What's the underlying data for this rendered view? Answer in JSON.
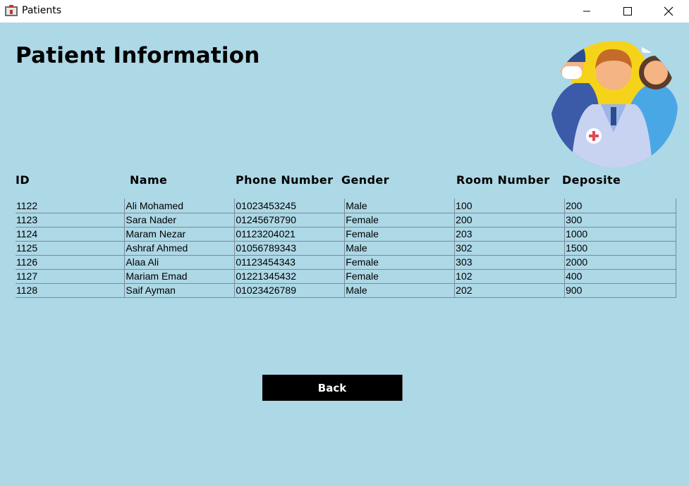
{
  "window": {
    "title": "Patients"
  },
  "page": {
    "title": "Patient Information"
  },
  "table": {
    "headers": [
      "ID",
      "Name",
      "Phone Number",
      "Gender",
      "Room Number",
      "Deposite"
    ],
    "rows": [
      [
        "1122",
        "Ali Mohamed",
        "01023453245",
        "Male",
        "100",
        "200"
      ],
      [
        "1123",
        "Sara Nader",
        "01245678790",
        "Female",
        "200",
        "300"
      ],
      [
        "1124",
        "Maram Nezar",
        "01123204021",
        "Female",
        "203",
        "1000"
      ],
      [
        "1125",
        "Ashraf Ahmed",
        "01056789343",
        "Male",
        "302",
        "1500"
      ],
      [
        "1126",
        "Alaa Ali",
        "01123454343",
        "Female",
        "303",
        "2000"
      ],
      [
        "1127",
        "Mariam Emad",
        "01221345432",
        "Female",
        "102",
        "400"
      ],
      [
        "1128",
        "Saif Ayman",
        "01023426789",
        "Male",
        "202",
        "900"
      ]
    ]
  },
  "buttons": {
    "back": "Back"
  },
  "icons": {
    "app": "hospital-app-icon",
    "minimize": "minimize-icon",
    "maximize": "maximize-icon",
    "close": "close-icon",
    "illustration": "medical-staff-illustration"
  },
  "colors": {
    "background": "#add8e6",
    "button": "#000000"
  }
}
